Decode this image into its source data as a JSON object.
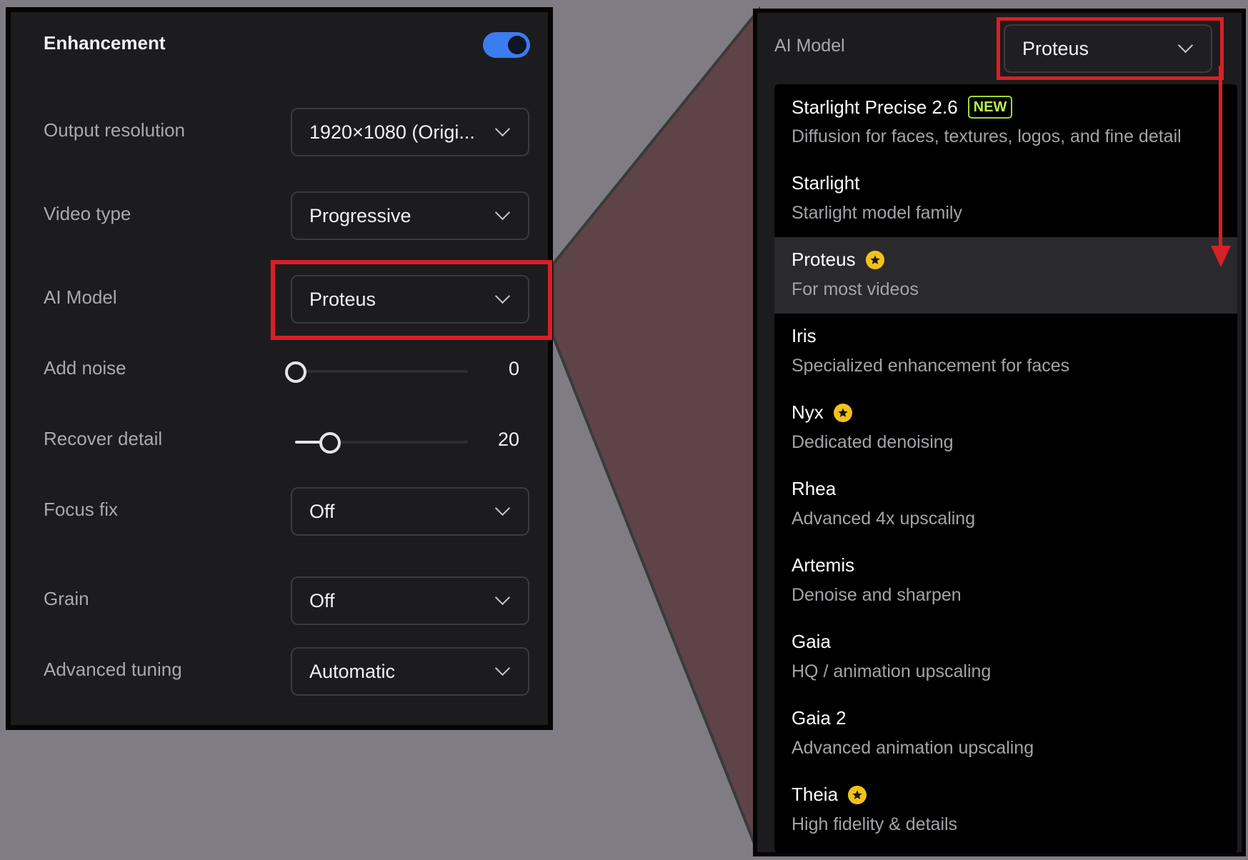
{
  "left_panel": {
    "title": "Enhancement",
    "toggle_on": true,
    "rows": {
      "output_resolution": {
        "label": "Output resolution",
        "value": "1920×1080 (Origi..."
      },
      "video_type": {
        "label": "Video type",
        "value": "Progressive"
      },
      "ai_model": {
        "label": "AI Model",
        "value": "Proteus"
      },
      "add_noise": {
        "label": "Add noise",
        "value": "0",
        "fraction": 0.0
      },
      "recover_detail": {
        "label": "Recover detail",
        "value": "20",
        "fraction": 0.2
      },
      "focus_fix": {
        "label": "Focus fix",
        "value": "Off"
      },
      "grain": {
        "label": "Grain",
        "value": "Off"
      },
      "advanced_tuning": {
        "label": "Advanced tuning",
        "value": "Automatic"
      }
    }
  },
  "right_panel": {
    "label": "AI Model",
    "selected": "Proteus",
    "new_badge": "NEW",
    "items": [
      {
        "title": "Starlight Precise 2.6",
        "desc": "Diffusion for faces, textures, logos, and fine detail",
        "badge": "new"
      },
      {
        "title": "Starlight",
        "desc": "Starlight model family"
      },
      {
        "title": "Proteus",
        "desc": "For most videos",
        "badge": "star",
        "selected": true
      },
      {
        "title": "Iris",
        "desc": "Specialized enhancement for faces"
      },
      {
        "title": "Nyx",
        "desc": "Dedicated denoising",
        "badge": "star"
      },
      {
        "title": "Rhea",
        "desc": "Advanced 4x upscaling"
      },
      {
        "title": "Artemis",
        "desc": "Denoise and sharpen"
      },
      {
        "title": "Gaia",
        "desc": "HQ / animation upscaling"
      },
      {
        "title": "Gaia 2",
        "desc": "Advanced animation upscaling"
      },
      {
        "title": "Theia",
        "desc": "High fidelity & details",
        "badge": "star"
      }
    ]
  },
  "colors": {
    "background": "#7f7c84",
    "panel": "#1c1c1e",
    "menu": "#000000",
    "accent_toggle": "#3b7cf0",
    "highlight_red": "#d91f26",
    "new_badge_green": "#b8f04a",
    "star_badge_gold": "#f2c21b",
    "connector": "#5e4449"
  },
  "icons": [
    "chevron-down-icon",
    "star-icon",
    "toggle-switch"
  ]
}
